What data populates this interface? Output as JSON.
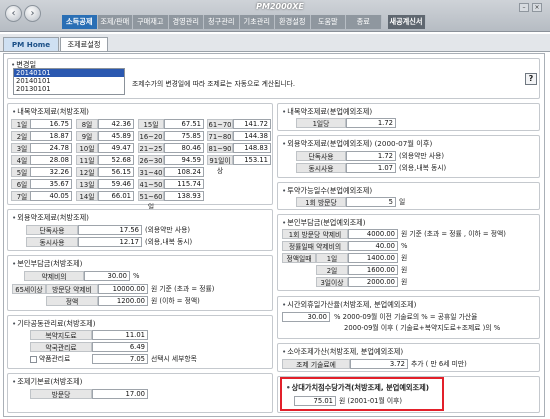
{
  "nav": {
    "back": "‹",
    "forward": "›"
  },
  "app": {
    "title": "PM2000XE"
  },
  "menu": [
    "소득공제",
    "조제/판매",
    "구매재고",
    "경영관리",
    "청구관리",
    "기초관리",
    "환경설정",
    "도움말",
    "종료"
  ],
  "menu_right": "새공계신서",
  "tabs": [
    "PM Home",
    "조제료설정"
  ],
  "change_date": {
    "label": "변경일",
    "items": [
      "20140101",
      "20140101",
      "20130101"
    ],
    "note": "조제수가의 변경일에 따라 조제료는 자동으로 계산됩니다.",
    "help": "?"
  },
  "sec1": {
    "title": "내복약조제료(처방조제)",
    "rows": [
      [
        "1일",
        "16.75",
        "8일",
        "42.36",
        "15일",
        "67.51",
        "61~70일",
        "141.72"
      ],
      [
        "2일",
        "18.87",
        "9일",
        "45.89",
        "16~20일",
        "75.85",
        "71~80일",
        "144.38"
      ],
      [
        "3일",
        "24.78",
        "10일",
        "49.47",
        "21~25일",
        "80.46",
        "81~90일",
        "148.83"
      ],
      [
        "4일",
        "28.08",
        "11일",
        "52.68",
        "26~30일",
        "94.59",
        "91일이상",
        "153.11"
      ],
      [
        "5일",
        "32.26",
        "12일",
        "56.15",
        "31~40일",
        "108.24",
        "",
        ""
      ],
      [
        "6일",
        "35.67",
        "13일",
        "59.46",
        "41~50일",
        "115.74",
        "",
        ""
      ],
      [
        "7일",
        "40.05",
        "14일",
        "66.01",
        "51~60일",
        "138.93",
        "",
        ""
      ]
    ]
  },
  "sec2": {
    "title": "외용약조제료(처방조제)",
    "rows": [
      [
        "단독사용",
        "17.56",
        "(외용약만 사용)"
      ],
      [
        "동시사용",
        "12.17",
        "(외용,내복 동시)"
      ]
    ]
  },
  "sec3": {
    "title": "본인부담금(처방조제)",
    "rate_label": "약제비의",
    "rate": "30.00",
    "rate_unit": "%",
    "aged_label": "65세이상",
    "visit_label": "방문당 약제비",
    "visit_value": "10000.00",
    "visit_tail": "원 기준 (초과 = 정률)",
    "flat_label": "정액",
    "flat_value": "1200.00",
    "flat_tail": "원    (이하 = 정액)"
  },
  "sec4": {
    "title": "기타공동관리료(처방조제)",
    "rows": [
      [
        "복약지도료",
        "11.01"
      ],
      [
        "약국관리료",
        "6.49"
      ]
    ],
    "check_label": "약품관리료",
    "check_value": "7.05",
    "check_tail": "선택시 세부항목"
  },
  "sec5": {
    "title": "조제기본료(처방조제)",
    "row": [
      "방문당",
      "17.00"
    ]
  },
  "r1": {
    "title": "내복약조제료(분업예외조제)",
    "row": [
      "1일당",
      "1.72"
    ]
  },
  "r2": {
    "title": "외용약조제료(분업예외조제) (2000-07월 이후)",
    "rows": [
      [
        "단독사용",
        "1.72",
        "(외용약만 사용)"
      ],
      [
        "동시사용",
        "1.07",
        "(외용,내복 동시)"
      ]
    ]
  },
  "r3": {
    "title": "투약가능일수(분업예외조제)",
    "row": [
      "1회 방문당",
      "5",
      "일"
    ]
  },
  "r4": {
    "title": "본인부담금(분업예외조제)",
    "visit_label": "1회 방문당 약제비",
    "visit_value": "4000.00",
    "visit_tail": "원 기준 (초과 = 정률 , 이하 = 정액)",
    "rate_label": "정률일때 약제비의",
    "rate_value": "40.00",
    "rate_unit": "%",
    "flat_rows": [
      [
        "정액일때",
        "1일",
        "1400.00",
        "원"
      ],
      [
        "",
        "2일",
        "1600.00",
        "원"
      ],
      [
        "",
        "3일이상",
        "2000.00",
        "원"
      ]
    ]
  },
  "r5": {
    "title": "시간외휴일가산율(처방조제, 분업예외조제)",
    "value": "30.00",
    "line1": "%  2000-09월 이전 기술료의 % = 공휴일 가산율",
    "line2": "2000-09월 이후 ( 기술료+복약지도료+조제료 )의  %"
  },
  "r6": {
    "title": "소아조제가산(처방조제, 분업예외조제)",
    "label": "조제 기술료에",
    "value": "3.72",
    "tail": "추가 ( 만 6세 미만)"
  },
  "r7": {
    "title": "상대가치점수당가격(처방조제, 분업예외조제)",
    "value": "75.01",
    "tail": "원 (2001-01월 이후)"
  }
}
